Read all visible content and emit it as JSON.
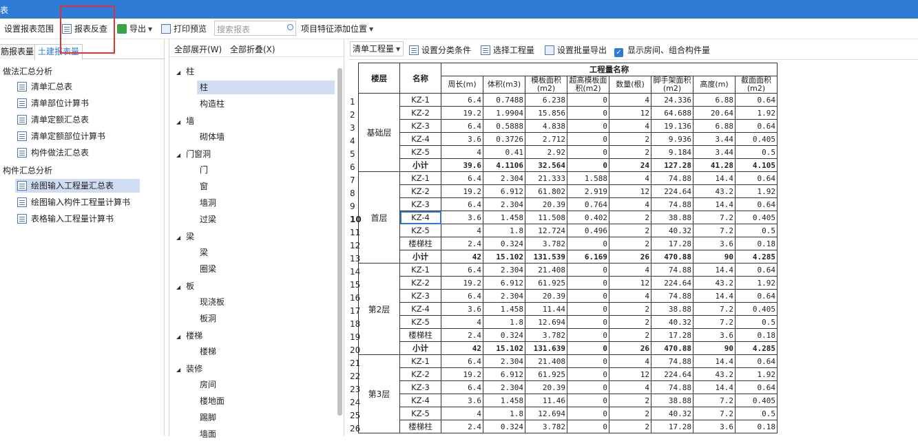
{
  "window": {
    "title": "表"
  },
  "toolbar": {
    "set_range": "设置报表范围",
    "report_check": "报表反查",
    "export": "导出",
    "print_preview": "打印预览",
    "search_placeholder": "搜索报表",
    "feature_position": "项目特征添加位置"
  },
  "left": {
    "tab_a": "筋报表量",
    "tab_b": "土建报表量",
    "group1": "做法汇总分析",
    "group1_items": [
      "清单汇总表",
      "清单部位计算书",
      "清单定额汇总表",
      "清单定额部位计算书",
      "构件做法汇总表"
    ],
    "group2": "构件汇总分析",
    "group2_items": [
      "绘图输入工程量汇总表",
      "绘图输入构件工程量计算书",
      "表格输入工程量计算书"
    ]
  },
  "middle": {
    "expand_all": "全部展开(W)",
    "collapse_all": "全部折叠(X)",
    "categories": [
      {
        "name": "柱",
        "items": [
          "柱",
          "构造柱"
        ]
      },
      {
        "name": "墙",
        "items": [
          "砌体墙"
        ]
      },
      {
        "name": "门窗洞",
        "items": [
          "门",
          "窗",
          "墙洞",
          "过梁"
        ]
      },
      {
        "name": "梁",
        "items": [
          "梁",
          "圈梁"
        ]
      },
      {
        "name": "板",
        "items": [
          "现浇板",
          "板洞"
        ]
      },
      {
        "name": "楼梯",
        "items": [
          "楼梯"
        ]
      },
      {
        "name": "装修",
        "items": [
          "房间",
          "楼地面",
          "踢脚",
          "墙面"
        ]
      }
    ]
  },
  "right": {
    "select_value": "清单工程量",
    "set_category": "设置分类条件",
    "choose_quantity": "选择工程量",
    "batch_export": "设置批量导出",
    "show_rooms": "显示房间、组合构件量",
    "table": {
      "col_floor": "楼层",
      "col_name": "名称",
      "group_header": "工程量名称",
      "cols": [
        "周长(m)",
        "体积(m3)",
        "模板面积(m2)",
        "超高模板面积(m2)",
        "数量(根)",
        "脚手架面积(m2)",
        "高度(m)",
        "截面面积(m2)"
      ],
      "floors": [
        {
          "floor": "基础层",
          "rows": [
            [
              "KZ-1",
              "6.4",
              "0.7488",
              "6.238",
              "0",
              "4",
              "24.336",
              "6.88",
              "0.64"
            ],
            [
              "KZ-2",
              "19.2",
              "1.9904",
              "15.856",
              "0",
              "12",
              "64.688",
              "20.64",
              "1.92"
            ],
            [
              "KZ-3",
              "6.4",
              "0.5888",
              "4.838",
              "0",
              "4",
              "19.136",
              "6.88",
              "0.64"
            ],
            [
              "KZ-4",
              "3.6",
              "0.3726",
              "2.712",
              "0",
              "2",
              "9.936",
              "3.44",
              "0.405"
            ],
            [
              "KZ-5",
              "4",
              "0.41",
              "2.92",
              "0",
              "2",
              "9.184",
              "3.44",
              "0.5"
            ],
            [
              "小计",
              "39.6",
              "4.1106",
              "32.564",
              "0",
              "24",
              "127.28",
              "41.28",
              "4.105"
            ]
          ]
        },
        {
          "floor": "首层",
          "rows": [
            [
              "KZ-1",
              "6.4",
              "2.304",
              "21.333",
              "1.588",
              "4",
              "74.88",
              "14.4",
              "0.64"
            ],
            [
              "KZ-2",
              "19.2",
              "6.912",
              "61.802",
              "2.919",
              "12",
              "224.64",
              "43.2",
              "1.92"
            ],
            [
              "KZ-3",
              "6.4",
              "2.304",
              "20.39",
              "0.764",
              "4",
              "74.88",
              "14.4",
              "0.64"
            ],
            [
              "KZ-4",
              "3.6",
              "1.458",
              "11.508",
              "0.402",
              "2",
              "38.88",
              "7.2",
              "0.405"
            ],
            [
              "KZ-5",
              "4",
              "1.8",
              "12.724",
              "0.496",
              "2",
              "40.32",
              "7.2",
              "0.5"
            ],
            [
              "楼梯柱",
              "2.4",
              "0.324",
              "3.782",
              "0",
              "2",
              "17.28",
              "3.6",
              "0.18"
            ],
            [
              "小计",
              "42",
              "15.102",
              "131.539",
              "6.169",
              "26",
              "470.88",
              "90",
              "4.285"
            ]
          ]
        },
        {
          "floor": "第2层",
          "rows": [
            [
              "KZ-1",
              "6.4",
              "2.304",
              "21.408",
              "0",
              "4",
              "74.88",
              "14.4",
              "0.64"
            ],
            [
              "KZ-2",
              "19.2",
              "6.912",
              "61.925",
              "0",
              "12",
              "224.64",
              "43.2",
              "1.92"
            ],
            [
              "KZ-3",
              "6.4",
              "2.304",
              "20.39",
              "0",
              "4",
              "74.88",
              "14.4",
              "0.64"
            ],
            [
              "KZ-4",
              "3.6",
              "1.458",
              "11.44",
              "0",
              "2",
              "38.88",
              "7.2",
              "0.405"
            ],
            [
              "KZ-5",
              "4",
              "1.8",
              "12.694",
              "0",
              "2",
              "40.32",
              "7.2",
              "0.5"
            ],
            [
              "楼梯柱",
              "2.4",
              "0.324",
              "3.782",
              "0",
              "2",
              "17.28",
              "3.6",
              "0.18"
            ],
            [
              "小计",
              "42",
              "15.102",
              "131.639",
              "0",
              "26",
              "470.88",
              "90",
              "4.285"
            ]
          ]
        },
        {
          "floor": "第3层",
          "rows": [
            [
              "KZ-1",
              "6.4",
              "2.304",
              "21.408",
              "0",
              "4",
              "74.88",
              "14.4",
              "0.64"
            ],
            [
              "KZ-2",
              "19.2",
              "6.912",
              "61.925",
              "0",
              "12",
              "224.64",
              "43.2",
              "1.92"
            ],
            [
              "KZ-3",
              "6.4",
              "2.304",
              "20.39",
              "0",
              "4",
              "74.88",
              "14.4",
              "0.64"
            ],
            [
              "KZ-4",
              "3.6",
              "1.458",
              "11.46",
              "0",
              "2",
              "38.88",
              "7.2",
              "0.405"
            ],
            [
              "KZ-5",
              "4",
              "1.8",
              "12.694",
              "0",
              "2",
              "40.32",
              "7.2",
              "0.5"
            ],
            [
              "楼梯柱",
              "2.4",
              "0.324",
              "3.782",
              "0",
              "2",
              "17.28",
              "3.6",
              "0.18"
            ]
          ]
        }
      ],
      "row_numbers": [
        "1",
        "2",
        "3",
        "4",
        "5",
        "6",
        "7",
        "8",
        "9",
        "10",
        "11",
        "12",
        "13",
        "14",
        "15",
        "16",
        "17",
        "18",
        "19",
        "20",
        "21",
        "22",
        "23",
        "24",
        "25",
        "26"
      ]
    }
  }
}
